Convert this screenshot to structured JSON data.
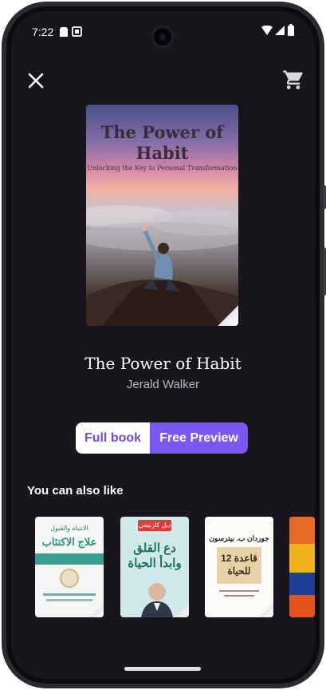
{
  "status_bar": {
    "time": "7:22"
  },
  "header": {
    "close_icon": "close-icon",
    "cart_icon": "cart-icon"
  },
  "book": {
    "cover_title": "The Power of Habit",
    "cover_subtitle": "Unlocking the Key to Personal Transformation",
    "title": "The Power of Habit",
    "author": "Jerald Walker"
  },
  "toggle": {
    "full_book": "Full book",
    "free_preview": "Free Preview",
    "selected": "Free Preview"
  },
  "recommendations": {
    "title": "You can also like",
    "items": [
      {
        "cover_top": "الانتباه والقبول",
        "cover_main": "علاج الاكتئاب"
      },
      {
        "cover_top": "ديل كارنيجي",
        "cover_main": "دع القلق وابدأ الحياة"
      },
      {
        "cover_top": "جوردان ب. بيترسون",
        "cover_main": "12 قاعدة للحياة"
      },
      {
        "cover_top": "",
        "cover_main": ""
      }
    ]
  },
  "colors": {
    "background": "#18161c",
    "accent": "#7b56f0",
    "accent_text": "#6d4ee0"
  }
}
